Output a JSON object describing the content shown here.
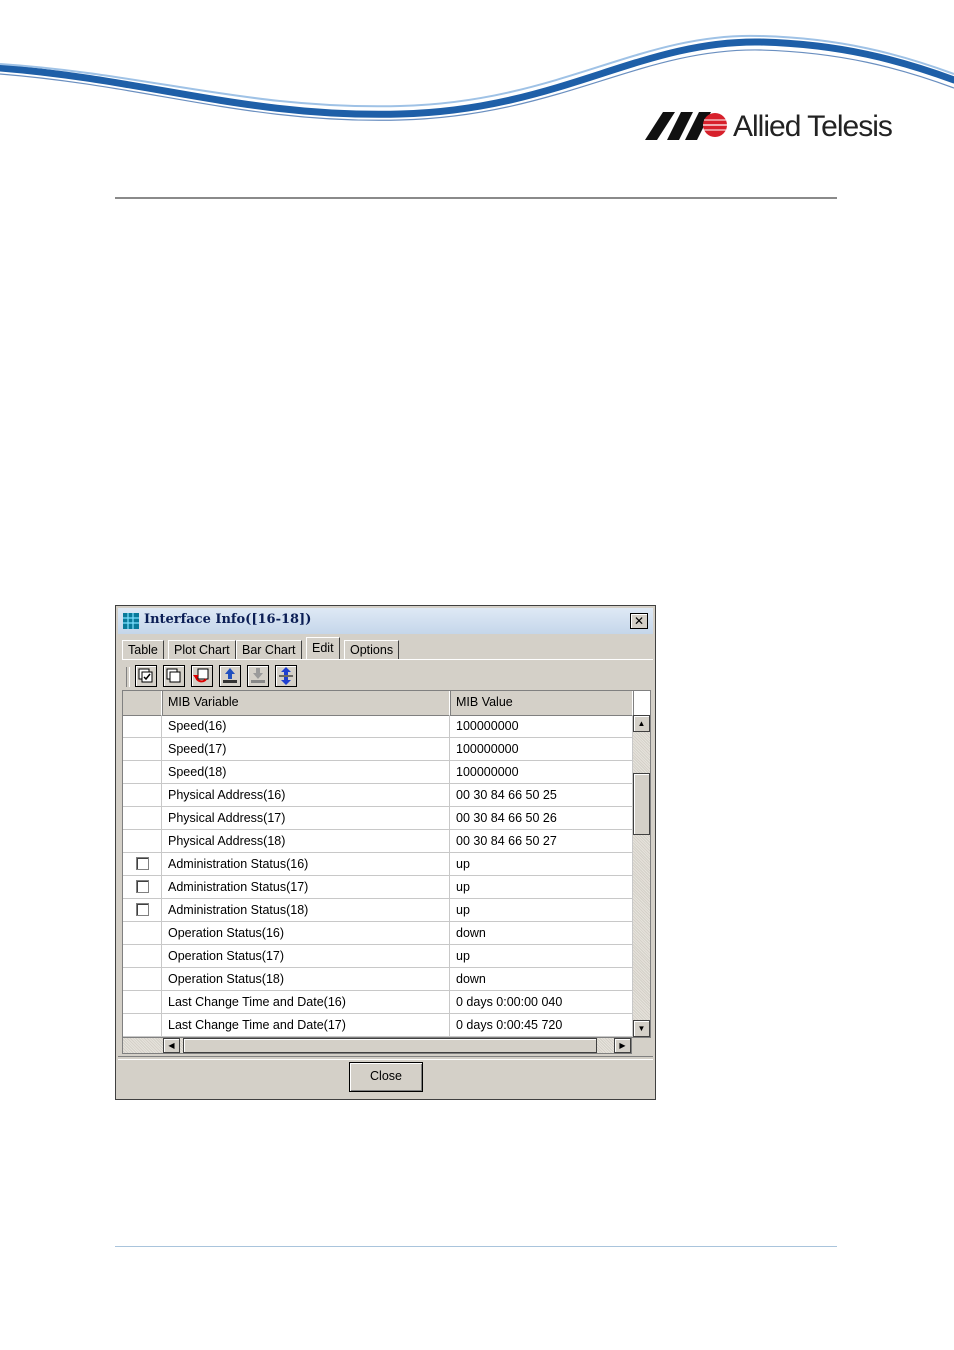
{
  "brand": {
    "name": "Allied Telesis"
  },
  "window": {
    "title": "Interface Info([16-18])",
    "close_glyph": "✕"
  },
  "tabs": [
    {
      "label": "Table",
      "active": false
    },
    {
      "label": "Plot Chart",
      "active": false
    },
    {
      "label": "Bar Chart",
      "active": false
    },
    {
      "label": "Edit",
      "active": true
    },
    {
      "label": "Options",
      "active": false
    }
  ],
  "toolbar": {
    "icons": [
      "select-all-icon",
      "deselect-all-icon",
      "undo-icon",
      "upload-icon",
      "download-icon",
      "refresh-icon"
    ]
  },
  "table": {
    "columns": [
      "",
      "MIB Variable",
      "MIB Value"
    ],
    "rows": [
      {
        "checkbox": false,
        "variable": "Speed(16)",
        "value": "100000000"
      },
      {
        "checkbox": false,
        "variable": "Speed(17)",
        "value": "100000000"
      },
      {
        "checkbox": false,
        "variable": "Speed(18)",
        "value": "100000000"
      },
      {
        "checkbox": false,
        "variable": "Physical Address(16)",
        "value": "00 30 84 66 50 25"
      },
      {
        "checkbox": false,
        "variable": "Physical Address(17)",
        "value": "00 30 84 66 50 26"
      },
      {
        "checkbox": false,
        "variable": "Physical Address(18)",
        "value": "00 30 84 66 50 27"
      },
      {
        "checkbox": true,
        "variable": "Administration Status(16)",
        "value": "up"
      },
      {
        "checkbox": true,
        "variable": "Administration Status(17)",
        "value": "up"
      },
      {
        "checkbox": true,
        "variable": "Administration Status(18)",
        "value": "up"
      },
      {
        "checkbox": false,
        "variable": "Operation Status(16)",
        "value": "down"
      },
      {
        "checkbox": false,
        "variable": "Operation Status(17)",
        "value": "up"
      },
      {
        "checkbox": false,
        "variable": "Operation Status(18)",
        "value": "down"
      },
      {
        "checkbox": false,
        "variable": "Last Change Time and Date(16)",
        "value": "0 days 0:00:00 040"
      },
      {
        "checkbox": false,
        "variable": "Last Change Time and Date(17)",
        "value": "0 days 0:00:45 720"
      }
    ]
  },
  "footer": {
    "close_label": "Close"
  },
  "colors": {
    "title_text": "#0b1e55",
    "swoosh": "#1e5fa8",
    "logo_red": "#d7202b"
  }
}
